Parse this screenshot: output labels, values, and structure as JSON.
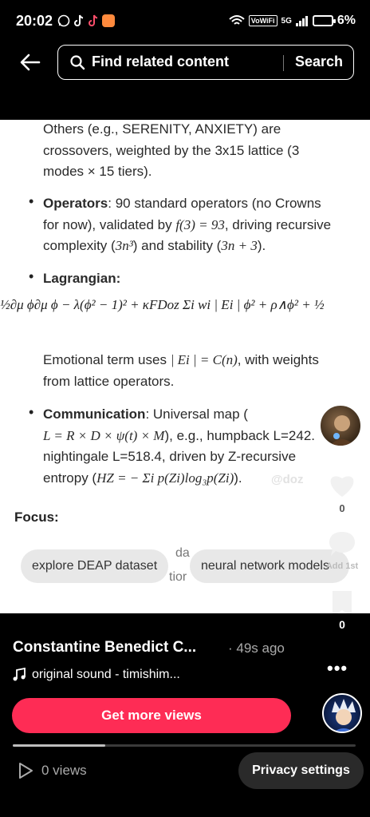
{
  "status_bar": {
    "time": "20:02",
    "vowifi": "VoWiFi",
    "signal": "5G",
    "battery": "6%"
  },
  "header": {
    "search_placeholder": "Find related content",
    "search_button": "Search"
  },
  "document": {
    "intro_lines": [
      "Others (e.g., SERENITY, ANXIETY) are",
      "crossovers, weighted by the 3x15 lattice (3",
      "modes × 15 tiers)."
    ],
    "operators": {
      "label": "Operators",
      "line1": ": 90 standard operators (no Crowns",
      "line2_pre": "for now), validated by ",
      "line2_math": "f(3) = 93",
      "line2_post": ", driving recursive",
      "line3_pre": "complexity (",
      "line3_math": "3n³",
      "line3_mid": ") and stability (",
      "line3_math2": "3n + 3",
      "line3_post": ")."
    },
    "lagrangian": {
      "label": "Lagrangian",
      "equation": "½∂μ ϕ∂μ ϕ − λ(ϕ² − 1)² + κFDoz Σi wi | Ei | ϕ² + ρ∧ϕ² + ½"
    },
    "emotional": {
      "line1_pre": "Emotional term uses ",
      "line1_math": "| Ei | = C(n)",
      "line1_post": ", with weights",
      "line2": "from lattice operators."
    },
    "communication": {
      "label": "Communication",
      "line1": ": Universal map (",
      "line2_math": "L = R × D × ψ(t) × M",
      "line2_post": "), e.g., humpback L=242.",
      "line3": "nightingale L=518.4, driven by Z-recursive",
      "line4_pre": "entropy (",
      "line4_math": "HZ = − Σi p(Zi)log₃p(Zi)",
      "line4_post": ")."
    },
    "watermark": "@doz",
    "focus": "Focus:",
    "blur_line1": "da",
    "blur_line2": "tior"
  },
  "suggestions": [
    "explore DEAP dataset",
    "neural network models"
  ],
  "actions": {
    "likes": "0",
    "comments": "Add 1st",
    "saves": "0"
  },
  "post": {
    "creator": "Constantine Benedict C...",
    "time_ago": "· 49s ago",
    "sound": "original sound - timishim...",
    "promote_button": "Get more views",
    "views": "0 views",
    "privacy_button": "Privacy settings",
    "progress": 0.27
  },
  "colors": {
    "accent": "#fe2c55",
    "background": "#000000",
    "document": "#ffffff"
  }
}
